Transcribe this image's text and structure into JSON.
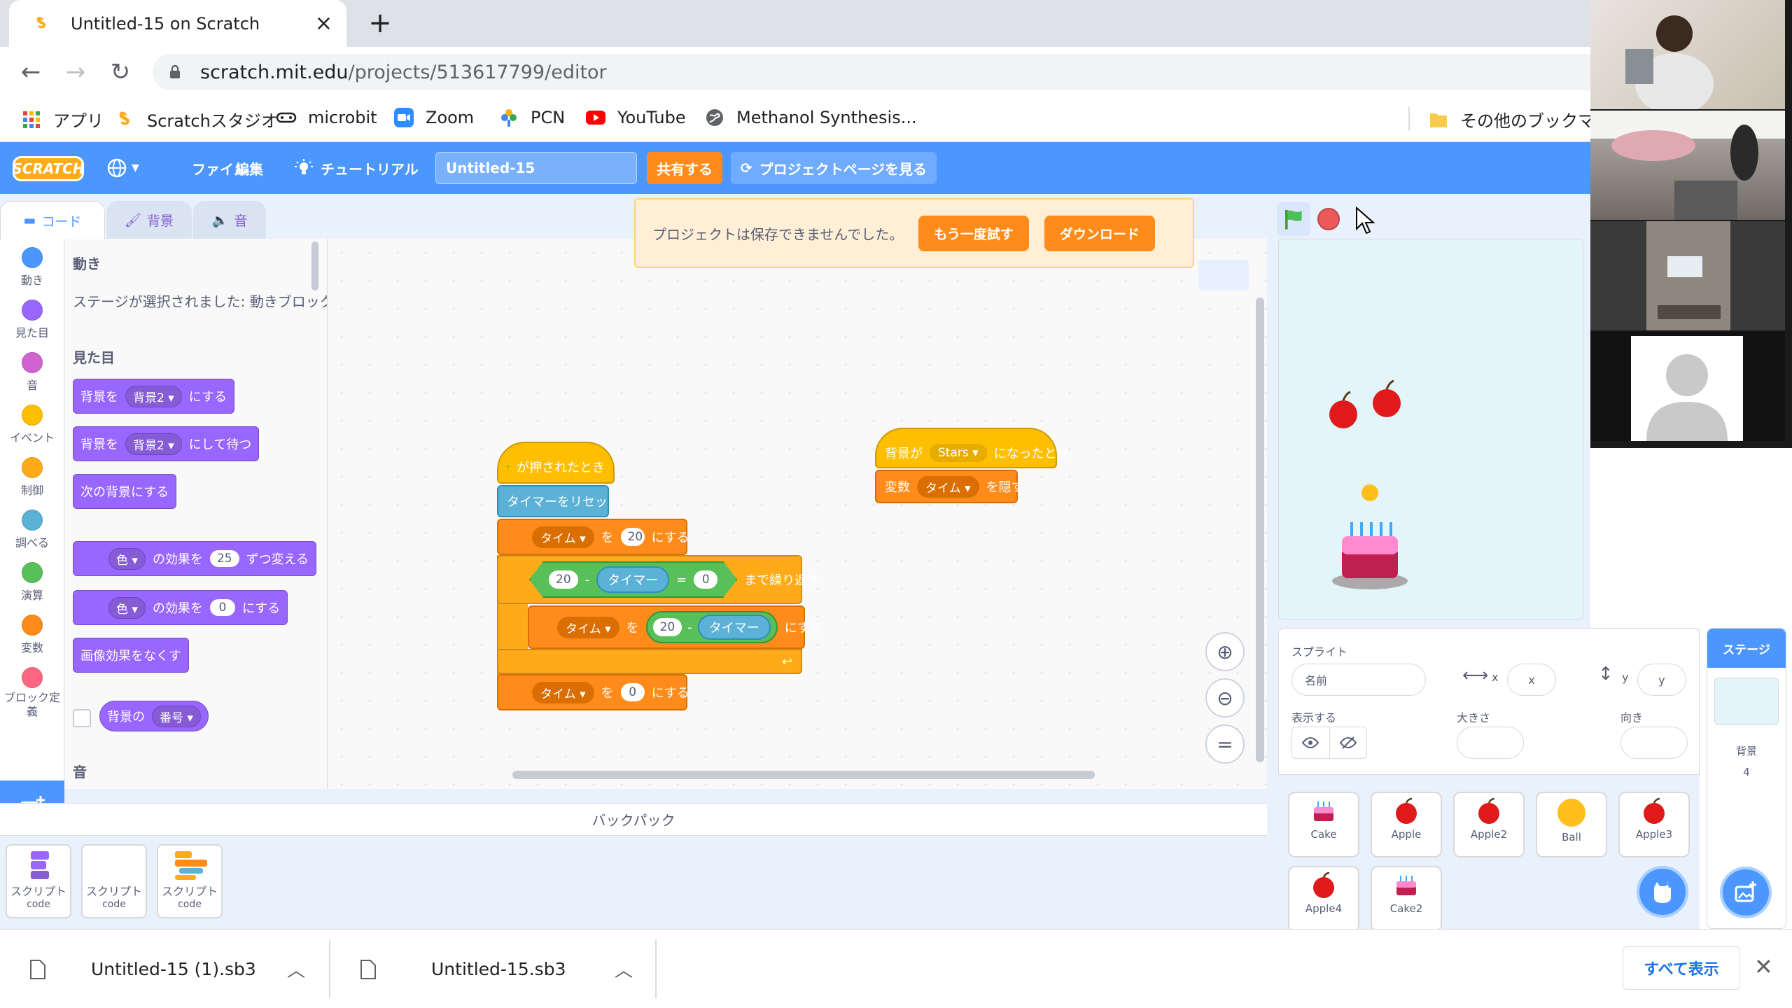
{
  "browser": {
    "tab_title": "Untitled-15 on Scratch",
    "url_host": "scratch.mit.edu",
    "url_path": "/projects/513617799/editor",
    "bookmarks": [
      "アプリ",
      "Scratchスタジオ",
      "microbit",
      "Zoom",
      "PCN",
      "YouTube",
      "Methanol Synthesis..."
    ],
    "other_bookmarks": "その他のブックマーク"
  },
  "menubar": {
    "logo": "SCRATCH",
    "file": "ファイル",
    "edit": "編集",
    "tutorials": "チュートリアル",
    "project_title": "Untitled-15",
    "share": "共有する",
    "see_project_page": "プロジェクトページを見る"
  },
  "editor_tabs": {
    "code": "コード",
    "backdrops": "背景",
    "sounds": "音"
  },
  "categories": [
    {
      "label": "動き",
      "color": "#4c97ff"
    },
    {
      "label": "見た目",
      "color": "#9966ff"
    },
    {
      "label": "音",
      "color": "#cf63cf"
    },
    {
      "label": "イベント",
      "color": "#ffbf00"
    },
    {
      "label": "制御",
      "color": "#ffab19"
    },
    {
      "label": "調べる",
      "color": "#5cb1d6"
    },
    {
      "label": "演算",
      "color": "#59c059"
    },
    {
      "label": "変数",
      "color": "#ff8c1a"
    },
    {
      "label": "ブロック定義",
      "color": "#ff6680"
    }
  ],
  "palette": {
    "motion_heading": "動き",
    "motion_note": "ステージが選択されました: 動きブロックは",
    "looks_heading": "見た目",
    "block1_a": "背景を",
    "block1_drop": "背景2",
    "block1_b": "にする",
    "block2_a": "背景を",
    "block2_drop": "背景2",
    "block2_b": "にして待つ",
    "block3": "次の背景にする",
    "block4_drop": "色",
    "block4_a": "の効果を",
    "block4_num": "25",
    "block4_b": "ずつ変える",
    "block5_drop": "色",
    "block5_a": "の効果を",
    "block5_num": "0",
    "block5_b": "にする",
    "block6": "画像効果をなくす",
    "block7_a": "背景の",
    "block7_drop": "番号",
    "sound_heading": "音"
  },
  "notice": {
    "text": "プロジェクトは保存できませんでした。",
    "retry": "もう一度試す",
    "download": "ダウンロード"
  },
  "script1": {
    "hat": "が押されたとき",
    "reset": "タイマーをリセット",
    "set1_var": "タイム",
    "set1_to": "を",
    "set1_val": "20",
    "set1_b": "にする",
    "repeat_a": "20",
    "repeat_minus": "-",
    "repeat_timer": "タイマー",
    "repeat_eq": "=",
    "repeat_b": "0",
    "repeat_label": "まで繰り返す",
    "set2_var": "タイム",
    "set2_to": "を",
    "set2_val": "20",
    "set2_minus": "-",
    "set2_timer": "タイマー",
    "set2_b": "にする",
    "set3_var": "タイム",
    "set3_to": "を",
    "set3_val": "0",
    "set3_b": "にする"
  },
  "script2": {
    "hat_a": "背景が",
    "hat_drop": "Stars",
    "hat_b": "になったとき",
    "hide_a": "変数",
    "hide_drop": "タイム",
    "hide_b": "を隠す"
  },
  "backpack": {
    "title": "バックパック",
    "items": [
      {
        "name": "スクリプト",
        "sub": "code"
      },
      {
        "name": "スクリプト",
        "sub": "code"
      },
      {
        "name": "スクリプト",
        "sub": "code"
      }
    ]
  },
  "sprite_info": {
    "sprite_label": "スプライト",
    "name_placeholder": "名前",
    "x_label": "x",
    "x_placeholder": "x",
    "y_label": "y",
    "y_placeholder": "y",
    "show_label": "表示する",
    "size_label": "大きさ",
    "direction_label": "向き"
  },
  "sprites": [
    "Cake",
    "Apple",
    "Apple2",
    "Ball",
    "Apple3",
    "Apple4",
    "Cake2"
  ],
  "stage_panel": {
    "title": "ステージ",
    "backdrops_label": "背景",
    "backdrops_count": "4"
  },
  "downloads": {
    "file1": "Untitled-15 (1).sb3",
    "file2": "Untitled-15.sb3",
    "show_all": "すべて表示"
  },
  "colors": {
    "scratch_blue": "#4c97ff",
    "looks": "#9966ff",
    "events": "#ffbf00",
    "control": "#ffab19",
    "variables": "#ff8c1a",
    "sensing": "#5cb1d6",
    "operators": "#59c059"
  }
}
